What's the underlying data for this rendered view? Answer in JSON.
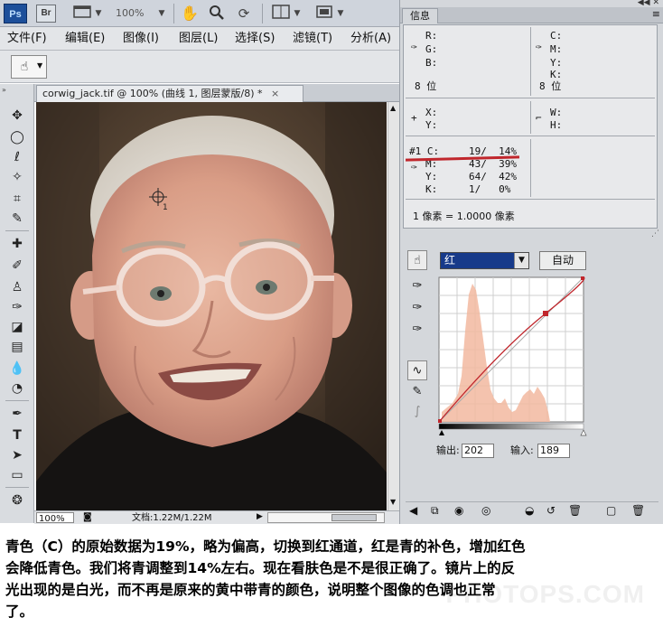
{
  "app": {
    "logo": "Ps",
    "bridge": "Br",
    "zoom": "100%"
  },
  "menu": [
    "文件(F)",
    "编辑(E)",
    "图像(I)",
    "图层(L)",
    "选择(S)",
    "滤镜(T)",
    "分析(A)"
  ],
  "document": {
    "tab": "corwig_jack.tif @ 100% (曲线 1, 图层蒙版/8) *",
    "status_zoom": "100%",
    "status_doc": "文档:1.22M/1.22M"
  },
  "info": {
    "tab": "信息",
    "r": "R:",
    "g": "G:",
    "b": "B:",
    "bit_l": "8 位",
    "c": "C:",
    "m": "M:",
    "y": "Y:",
    "k": "K:",
    "bit_r": "8 位",
    "x": "X:",
    "y2": "Y:",
    "w": "W:",
    "h": "H:",
    "s1c": "#1 C:",
    "s1c_val": "19/  14%",
    "s1m": "M:",
    "s1m_val": "43/  39%",
    "s1y": "Y:",
    "s1y_val": "64/  42%",
    "s1k": "K:",
    "s1k_val": "1/   0%",
    "pixel": "1 像素 = 1.0000 像素"
  },
  "curves": {
    "channel": "红",
    "auto": "自动",
    "output_label": "输出:",
    "output_value": "202",
    "input_label": "输入:",
    "input_value": "189"
  },
  "caption": {
    "line1": "青色（C）的原始数据为19%，略为偏高，切换到红通道，红是青的补色，增加红色",
    "line2": "会降低青色。我们将青调整到14%左右。现在看肤色是不是很正确了。镜片上的反",
    "line3": "光出现的是白光，而不再是原来的黄中带青的颜色，说明整个图像的色调也正常",
    "line4": "了。",
    "watermark": "PHOTOPS.COM"
  },
  "colors": {
    "accent_line": "#c0262c",
    "histogram": "#f2b9a0"
  }
}
